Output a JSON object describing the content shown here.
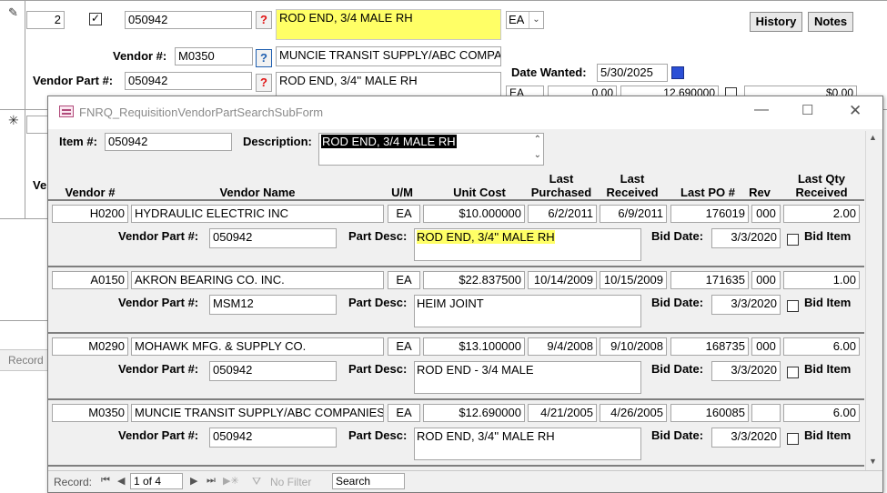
{
  "main_form": {
    "line_no": "2",
    "item_no": "050942",
    "description": "ROD END, 3/4 MALE RH",
    "um": "EA",
    "history_label": "History",
    "notes_label": "Notes",
    "vendor_label": "Vendor #:",
    "vendor_no": "M0350",
    "vendor_name": "MUNCIE TRANSIT SUPPLY/ABC COMPAN",
    "vendor_part_label": "Vendor Part #:",
    "vendor_part": "050942",
    "part_desc": "ROD END, 3/4'' MALE RH",
    "date_wanted_label": "Date Wanted:",
    "date_wanted": "5/30/2025",
    "um2": "EA",
    "qty": "0.00",
    "cost": "12.690000",
    "total": "$0.00",
    "new_row_vendor_label": "Ve",
    "records_label": "Record"
  },
  "popup": {
    "title": "FNRQ_RequisitionVendorPartSearchSubForm",
    "item_label": "Item #:",
    "item_no": "050942",
    "description_label": "Description:",
    "description": "ROD END, 3/4 MALE RH",
    "columns": {
      "vendor_no": "Vendor #",
      "vendor_name": "Vendor Name",
      "um": "U/M",
      "unit_cost": "Unit Cost",
      "last_purchased": "Last Purchased",
      "last_received": "Last Received",
      "last_po": "Last PO #",
      "rev": "Rev",
      "last_qty": "Last Qty Received"
    },
    "labels": {
      "vendor_part": "Vendor Part #:",
      "part_desc": "Part Desc:",
      "bid_date": "Bid Date:",
      "bid_item": "Bid Item"
    },
    "rows": [
      {
        "vendor_no": "H0200",
        "vendor_name": "HYDRAULIC ELECTRIC INC",
        "um": "EA",
        "unit_cost": "$10.000000",
        "last_purchased": "6/2/2011",
        "last_received": "6/9/2011",
        "last_po": "176019",
        "rev": "000",
        "last_qty": "2.00",
        "vendor_part": "050942",
        "part_desc": "ROD END, 3/4'' MALE RH",
        "bid_date": "3/3/2020"
      },
      {
        "vendor_no": "A0150",
        "vendor_name": "AKRON BEARING CO. INC.",
        "um": "EA",
        "unit_cost": "$22.837500",
        "last_purchased": "10/14/2009",
        "last_received": "10/15/2009",
        "last_po": "171635",
        "rev": "000",
        "last_qty": "1.00",
        "vendor_part": "MSM12",
        "part_desc": "HEIM JOINT",
        "bid_date": "3/3/2020"
      },
      {
        "vendor_no": "M0290",
        "vendor_name": "MOHAWK MFG. & SUPPLY CO.",
        "um": "EA",
        "unit_cost": "$13.100000",
        "last_purchased": "9/4/2008",
        "last_received": "9/10/2008",
        "last_po": "168735",
        "rev": "000",
        "last_qty": "6.00",
        "vendor_part": "050942",
        "part_desc": "ROD END - 3/4 MALE",
        "bid_date": "3/3/2020"
      },
      {
        "vendor_no": "M0350",
        "vendor_name": "MUNCIE TRANSIT SUPPLY/ABC COMPANIES",
        "um": "EA",
        "unit_cost": "$12.690000",
        "last_purchased": "4/21/2005",
        "last_received": "4/26/2005",
        "last_po": "160085",
        "rev": "",
        "last_qty": "6.00",
        "vendor_part": "050942",
        "part_desc": "ROD END, 3/4'' MALE RH",
        "bid_date": "3/3/2020"
      }
    ],
    "nav": {
      "record_label": "Record:",
      "position": "1 of 4",
      "no_filter": "No Filter",
      "search": "Search"
    }
  },
  "colors": {
    "highlight": "#ffff66",
    "question_red": "#e01010",
    "calendar_blue": "#2b4fd6"
  }
}
